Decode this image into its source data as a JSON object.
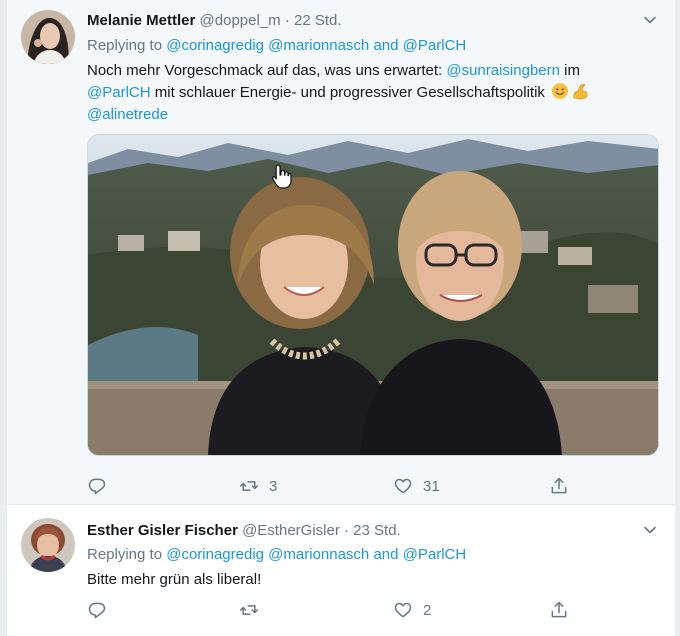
{
  "tweets": [
    {
      "author": "Melanie Mettler",
      "handle": "@doppel_m",
      "separator": "·",
      "time": "22 Std.",
      "reply_prefix": "Replying to",
      "reply_mention_1": "@corinagredig",
      "reply_mention_2": "@marionnasch",
      "reply_and": "and",
      "reply_mention_3": "@ParlCH",
      "text_part1": "Noch mehr Vorgeschmack auf das, was uns erwartet:",
      "text_mention_1": "@sunraisingbern",
      "text_part2": "im",
      "text_mention_2": "@ParlCH",
      "text_part3": "mit schlauer Energie- und progressiver Gesellschaftspolitik",
      "text_mention_3": "@alinetrede",
      "emojis": [
        "smiling-face",
        "flexed-biceps"
      ],
      "replies": "",
      "retweets": "3",
      "likes": "31"
    },
    {
      "author": "Esther Gisler Fischer",
      "handle": "@EstherGisler",
      "separator": "·",
      "time": "23 Std.",
      "reply_prefix": "Replying to",
      "reply_mention_1": "@corinagredig",
      "reply_mention_2": "@marionnasch",
      "reply_and": "and",
      "reply_mention_3": "@ParlCH",
      "text": "Bitte mehr grün als liberal!",
      "replies": "",
      "retweets": "",
      "likes": "2"
    }
  ],
  "colors": {
    "link": "#1b95e0",
    "muted": "#657786",
    "text": "#14171a",
    "hover_bg": "#f5f8fa"
  }
}
